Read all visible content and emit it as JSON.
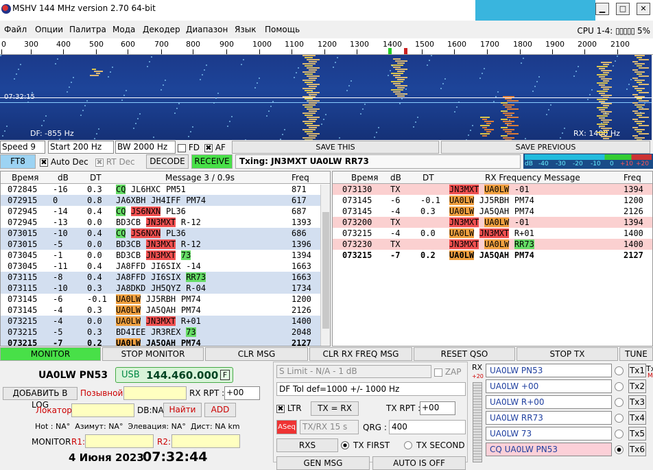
{
  "window": {
    "title": "MSHV 144 MHz version 2.70 64-bit",
    "min": "▁",
    "max": "□",
    "close": "✕"
  },
  "menu": [
    "Файл",
    "Опции",
    "Палитра",
    "Мода",
    "Декодер",
    "Диапазон",
    "Язык",
    "Помощь"
  ],
  "cpu": "CPU 1-4:",
  "cpu_pct": "5%",
  "ruler": [
    "0",
    "300",
    "400",
    "500",
    "600",
    "700",
    "800",
    "900",
    "1000",
    "1100",
    "1200",
    "1300",
    "1400",
    "1500",
    "1600",
    "1700",
    "1800",
    "1900",
    "2000",
    "2100"
  ],
  "waterfall": {
    "time": "07:32:15",
    "df": "DF: -855 Hz",
    "rx": "RX: 1400 Hz"
  },
  "controls": {
    "speed": "Speed 9",
    "start": "Start 200 Hz",
    "bw": "BW 2000 Hz",
    "fd": "FD",
    "af": "AF",
    "save_this": "SAVE THIS",
    "save_prev": "SAVE PREVIOUS"
  },
  "moderow": {
    "mode": "FT8",
    "auto_dec": "Auto Dec",
    "rt_dec": "RT Dec",
    "decode": "DECODE",
    "receive": "RECEIVE",
    "txing": "Txing: JN3MXT UA0LW RR73"
  },
  "meter": {
    "db": "dB",
    "labels": [
      "-40",
      "-30",
      "-20",
      "-10",
      "0",
      "+10",
      "+20"
    ]
  },
  "left_table": {
    "headers": [
      "Время",
      "dB",
      "DT",
      "Message 3 / 0.9s",
      "Freq"
    ],
    "rows": [
      {
        "t": "072845",
        "db": "-16",
        "dt": "0.3",
        "msg": [
          [
            "CQ",
            "g"
          ],
          [
            "JL6HXC",
            ""
          ],
          [
            "PM51",
            ""
          ]
        ],
        "f": "871",
        "alt": false
      },
      {
        "t": "072915",
        "db": "0",
        "dt": "0.8",
        "msg": [
          [
            "JA6XBH",
            ""
          ],
          [
            "JH4IFF",
            ""
          ],
          [
            "PM74",
            ""
          ]
        ],
        "f": "617",
        "alt": true
      },
      {
        "t": "072945",
        "db": "-14",
        "dt": "0.4",
        "msg": [
          [
            "CQ",
            "g"
          ],
          [
            "JS6NXN",
            "r"
          ],
          [
            "PL36",
            ""
          ]
        ],
        "f": "687",
        "alt": false
      },
      {
        "t": "072945",
        "db": "-13",
        "dt": "0.0",
        "msg": [
          [
            "BD3CB",
            ""
          ],
          [
            "JN3MXT",
            "r"
          ],
          [
            "R-12",
            ""
          ]
        ],
        "f": "1393",
        "alt": false
      },
      {
        "t": "073015",
        "db": "-10",
        "dt": "0.4",
        "msg": [
          [
            "CQ",
            "g"
          ],
          [
            "JS6NXN",
            "r"
          ],
          [
            "PL36",
            ""
          ]
        ],
        "f": "686",
        "alt": true
      },
      {
        "t": "073015",
        "db": "-5",
        "dt": "0.0",
        "msg": [
          [
            "BD3CB",
            ""
          ],
          [
            "JN3MXT",
            "r"
          ],
          [
            "R-12",
            ""
          ]
        ],
        "f": "1396",
        "alt": true
      },
      {
        "t": "073045",
        "db": "-1",
        "dt": "0.0",
        "msg": [
          [
            "BD3CB",
            ""
          ],
          [
            "JN3MXT",
            "r"
          ],
          [
            "73",
            "g"
          ]
        ],
        "f": "1394",
        "alt": false
      },
      {
        "t": "073045",
        "db": "-11",
        "dt": "0.4",
        "msg": [
          [
            "JA8FFD",
            ""
          ],
          [
            "JI6SIX",
            ""
          ],
          [
            "-14",
            ""
          ]
        ],
        "f": "1663",
        "alt": false
      },
      {
        "t": "073115",
        "db": "-8",
        "dt": "0.4",
        "msg": [
          [
            "JA8FFD",
            ""
          ],
          [
            "JI6SIX",
            ""
          ],
          [
            "RR73",
            "g"
          ]
        ],
        "f": "1663",
        "alt": true
      },
      {
        "t": "073115",
        "db": "-10",
        "dt": "0.3",
        "msg": [
          [
            "JA8DKD",
            ""
          ],
          [
            "JH5QYZ",
            ""
          ],
          [
            "R-04",
            ""
          ]
        ],
        "f": "1734",
        "alt": true
      },
      {
        "t": "073145",
        "db": "-6",
        "dt": "-0.1",
        "msg": [
          [
            "UA0LW",
            "o"
          ],
          [
            "JJ5RBH",
            ""
          ],
          [
            "PM74",
            ""
          ]
        ],
        "f": "1200",
        "alt": false
      },
      {
        "t": "073145",
        "db": "-4",
        "dt": "0.3",
        "msg": [
          [
            "UA0LW",
            "o"
          ],
          [
            "JA5QAH",
            ""
          ],
          [
            "PM74",
            ""
          ]
        ],
        "f": "2126",
        "alt": false
      },
      {
        "t": "073215",
        "db": "-4",
        "dt": "0.0",
        "msg": [
          [
            "UA0LW",
            "o"
          ],
          [
            "JN3MXT",
            "r"
          ],
          [
            "R+01",
            ""
          ]
        ],
        "f": "1400",
        "alt": true
      },
      {
        "t": "073215",
        "db": "-5",
        "dt": "0.3",
        "msg": [
          [
            "BD4IEE",
            ""
          ],
          [
            "JR3REX",
            ""
          ],
          [
            "73",
            "g"
          ]
        ],
        "f": "2048",
        "alt": true
      },
      {
        "t": "073215",
        "db": "-7",
        "dt": "0.2",
        "msg": [
          [
            "UA0LW",
            "o"
          ],
          [
            "JA5QAH",
            ""
          ],
          [
            "PM74",
            ""
          ]
        ],
        "f": "2127",
        "alt": true,
        "bold": true
      }
    ]
  },
  "right_table": {
    "headers": [
      "Время",
      "dB",
      "DT",
      "RX Frequency Message",
      "Freq"
    ],
    "rows": [
      {
        "t": "073130",
        "db": "TX",
        "dt": "",
        "msg": [
          [
            "JN3MXT",
            "r"
          ],
          [
            "UA0LW",
            "o"
          ],
          [
            "-01",
            ""
          ]
        ],
        "f": "1394",
        "tx": true
      },
      {
        "t": "073145",
        "db": "-6",
        "dt": "-0.1",
        "msg": [
          [
            "UA0LW",
            "o"
          ],
          [
            "JJ5RBH",
            ""
          ],
          [
            "PM74",
            ""
          ]
        ],
        "f": "1200",
        "tx": false
      },
      {
        "t": "073145",
        "db": "-4",
        "dt": "0.3",
        "msg": [
          [
            "UA0LW",
            "o"
          ],
          [
            "JA5QAH",
            ""
          ],
          [
            "PM74",
            ""
          ]
        ],
        "f": "2126",
        "tx": false
      },
      {
        "t": "073200",
        "db": "TX",
        "dt": "",
        "msg": [
          [
            "JN3MXT",
            "r"
          ],
          [
            "UA0LW",
            "o"
          ],
          [
            "-01",
            ""
          ]
        ],
        "f": "1394",
        "tx": true
      },
      {
        "t": "073215",
        "db": "-4",
        "dt": "0.0",
        "msg": [
          [
            "UA0LW",
            "o"
          ],
          [
            "JN3MXT",
            "r"
          ],
          [
            "R+01",
            ""
          ]
        ],
        "f": "1400",
        "tx": false
      },
      {
        "t": "073230",
        "db": "TX",
        "dt": "",
        "msg": [
          [
            "JN3MXT",
            "r"
          ],
          [
            "UA0LW",
            "o"
          ],
          [
            "RR73",
            "g"
          ]
        ],
        "f": "1400",
        "tx": true
      },
      {
        "t": "073215",
        "db": "-7",
        "dt": "0.2",
        "msg": [
          [
            "UA0LW",
            "o"
          ],
          [
            "JA5QAH",
            ""
          ],
          [
            "PM74",
            ""
          ]
        ],
        "f": "2127",
        "tx": false,
        "bold": true
      }
    ]
  },
  "buttons": {
    "monitor": "MONITOR",
    "stop_monitor": "STOP MONITOR",
    "clr_msg": "CLR MSG",
    "clr_rx": "CLR RX FREQ MSG",
    "reset_qso": "RESET QSO",
    "stop_tx": "STOP TX",
    "tune": "TUNE"
  },
  "station": {
    "call": "UA0LW PN53",
    "mode": "USB",
    "freq": "144.460.000",
    "f": "F",
    "add_log": "ДОБАВИТЬ В LOG",
    "callsign_lbl": "Позывной:",
    "rx_rpt_lbl": "RX RPT :",
    "rx_rpt": "+00",
    "locator_lbl": "Локатор:",
    "dbna": "DB:NA",
    "find": "Найти",
    "add": "ADD",
    "info": "Hot : NA°  Азимут: NA°  Элевация: NA°  Дист: NA km",
    "monitor_lbl": "MONITOR",
    "r1": "R1:",
    "r2": "R2:",
    "date": "4 Июня 2023",
    "time": "07:32:44"
  },
  "mid": {
    "slimit": "S Limit - N/A - 1  dB",
    "zap": "ZAP",
    "dftol": "DF Tol def=1000 +/-  1000  Hz",
    "ltr": "LTR",
    "tx": "TX",
    "eq": "=",
    "rx": "RX",
    "tx_rpt_lbl": "TX RPT :",
    "tx_rpt": "+00",
    "aseq": "ASeq",
    "txrx": "TX/RX 15  s",
    "qrg_lbl": "QRG :",
    "qrg": "400",
    "rxs": "RXS",
    "tx_first": "TX FIRST",
    "tx_second": "TX SECOND",
    "gen_msg": "GEN MSG",
    "auto_is_off": "AUTO IS OFF"
  },
  "rxmeter": {
    "label": "RX",
    "top": "+20"
  },
  "tx_msgs": [
    {
      "text": "UA0LW PN53",
      "btn": "Tx1"
    },
    {
      "text": "UA0LW +00",
      "btn": "Tx2"
    },
    {
      "text": "UA0LW R+00",
      "btn": "Tx3"
    },
    {
      "text": "UA0LW RR73",
      "btn": "Tx4"
    },
    {
      "text": "UA0LW 73",
      "btn": "Tx5"
    },
    {
      "text": "CQ UA0LW PN53",
      "btn": "Tx6"
    }
  ],
  "txm": "Tx",
  "txm2": "M"
}
